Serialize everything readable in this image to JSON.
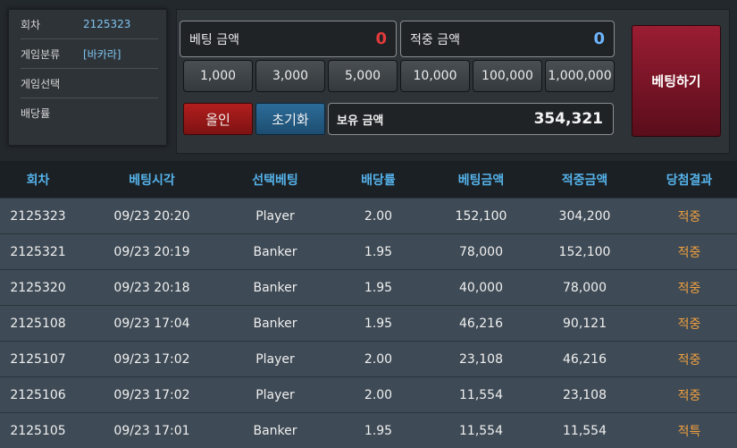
{
  "info": {
    "round_label": "회차",
    "round_value": "2125323",
    "category_label": "게임분류",
    "category_value": "[바카라]",
    "selection_label": "게임선택",
    "selection_value": "",
    "odds_label": "배당률",
    "odds_value": ""
  },
  "bet": {
    "bet_amount_label": "베팅 금액",
    "bet_amount_value": "0",
    "win_amount_label": "적중 금액",
    "win_amount_value": "0",
    "chips": [
      "1,000",
      "3,000",
      "5,000",
      "10,000",
      "100,000",
      "1,000,000"
    ],
    "allin_label": "올인",
    "reset_label": "초기화",
    "balance_label": "보유 금액",
    "balance_value": "354,321",
    "submit_label": "베팅하기"
  },
  "table": {
    "headers": [
      "회차",
      "베팅시각",
      "선택베팅",
      "배당률",
      "베팅금액",
      "적중금액",
      "당첨결과"
    ],
    "rows": [
      [
        "2125323",
        "09/23 20:20",
        "Player",
        "2.00",
        "152,100",
        "304,200",
        "적중"
      ],
      [
        "2125321",
        "09/23 20:19",
        "Banker",
        "1.95",
        "78,000",
        "152,100",
        "적중"
      ],
      [
        "2125320",
        "09/23 20:18",
        "Banker",
        "1.95",
        "40,000",
        "78,000",
        "적중"
      ],
      [
        "2125108",
        "09/23 17:04",
        "Banker",
        "1.95",
        "46,216",
        "90,121",
        "적중"
      ],
      [
        "2125107",
        "09/23 17:02",
        "Player",
        "2.00",
        "23,108",
        "46,216",
        "적중"
      ],
      [
        "2125106",
        "09/23 17:02",
        "Player",
        "2.00",
        "11,554",
        "23,108",
        "적중"
      ],
      [
        "2125105",
        "09/23 17:01",
        "Banker",
        "1.95",
        "11,554",
        "11,554",
        "적특"
      ]
    ]
  },
  "colors": {
    "accent": "#55b2ea",
    "bet_red": "#e23b3b",
    "win_blue": "#6fb6ff",
    "result_orange": "#f0a040"
  }
}
